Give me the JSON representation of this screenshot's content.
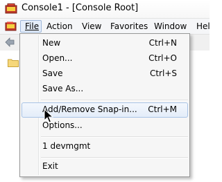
{
  "window": {
    "title": "Console1 - [Console Root]"
  },
  "menubar": {
    "items": [
      "File",
      "Action",
      "View",
      "Favorites",
      "Window",
      "Help"
    ]
  },
  "file_menu": {
    "items": [
      {
        "label": "New",
        "shortcut": "Ctrl+N"
      },
      {
        "label": "Open...",
        "shortcut": "Ctrl+O"
      },
      {
        "label": "Save",
        "shortcut": "Ctrl+S"
      },
      {
        "label": "Save As...",
        "shortcut": ""
      },
      {
        "label": "Add/Remove Snap-in...",
        "shortcut": "Ctrl+M"
      },
      {
        "label": "Options...",
        "shortcut": ""
      },
      {
        "label": "1 devmgmt",
        "shortcut": ""
      },
      {
        "label": "Exit",
        "shortcut": ""
      }
    ],
    "highlighted": "Add/Remove Snap-in..."
  },
  "icons": {
    "app": "mmc-console-icon",
    "doc": "console-doc-icon",
    "back": "back-arrow-icon",
    "folder": "folder-icon",
    "cursor": "mouse-pointer-icon"
  },
  "colors": {
    "highlight_bg": "#e4edf9",
    "highlight_border": "#a8c3e6",
    "menu_bg": "#f6f6f6",
    "menu_border": "#979797"
  }
}
